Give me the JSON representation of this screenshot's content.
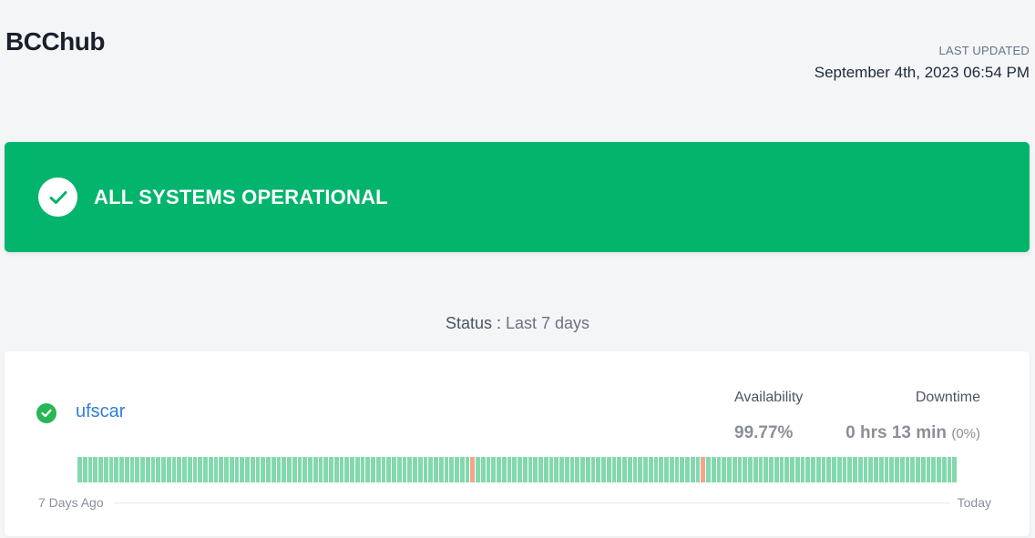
{
  "header": {
    "brand": "BCChub",
    "last_updated_label": "LAST UPDATED",
    "last_updated_value": "September 4th, 2023 06:54 PM"
  },
  "banner": {
    "text": "ALL SYSTEMS OPERATIONAL",
    "icon": "check-circle-icon",
    "color": "#03b56c"
  },
  "status": {
    "label": "Status :",
    "period": "Last 7 days"
  },
  "service": {
    "name": "ufscar",
    "icon": "check-circle-icon",
    "status_color": "#28b656",
    "availability_label": "Availability",
    "availability_value": "99.77%",
    "downtime_label": "Downtime",
    "downtime_value": "0 hrs 13 min",
    "downtime_percent": "(0%)",
    "uptime_bar_count": 168,
    "incident_bar_indices": [
      75,
      119
    ],
    "up_color": "#82d9ad",
    "incident_color": "#f3a58c",
    "axis_start": "7 Days Ago",
    "axis_end": "Today"
  }
}
